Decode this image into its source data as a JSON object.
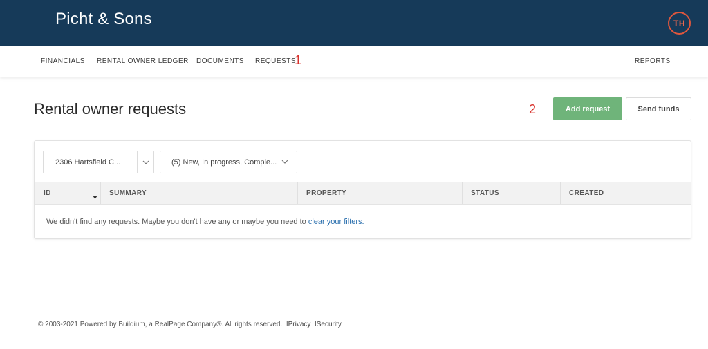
{
  "header": {
    "company_name": "Picht & Sons",
    "avatar_initials": "TH",
    "background_color": "#163a59",
    "avatar_color": "#e0573d"
  },
  "nav": {
    "items": [
      {
        "label": "FINANCIALS"
      },
      {
        "label": "RENTAL OWNER LEDGER"
      },
      {
        "label": "DOCUMENTS"
      },
      {
        "label": "REQUESTS"
      }
    ],
    "right_item": "REPORTS"
  },
  "annotations": {
    "marker_1": "1",
    "marker_2": "2",
    "color": "#d9312b"
  },
  "page": {
    "title": "Rental owner requests"
  },
  "actions": {
    "add_request": "Add request",
    "send_funds": "Send funds",
    "primary_color": "#6fb47a"
  },
  "filters": {
    "property": "2306 Hartsfield C...",
    "status": "(5) New, In progress, Comple..."
  },
  "table": {
    "columns": [
      "ID",
      "SUMMARY",
      "PROPERTY",
      "STATUS",
      "CREATED"
    ],
    "empty_message": "We didn't find any requests. Maybe you don't have any or maybe you need to",
    "empty_link": "clear your filters."
  },
  "footer": {
    "copyright": "© 2003-2021 Powered by Buildium, a RealPage Company®. All rights reserved.",
    "privacy": "Privacy",
    "security": "Security",
    "separator": "I"
  }
}
